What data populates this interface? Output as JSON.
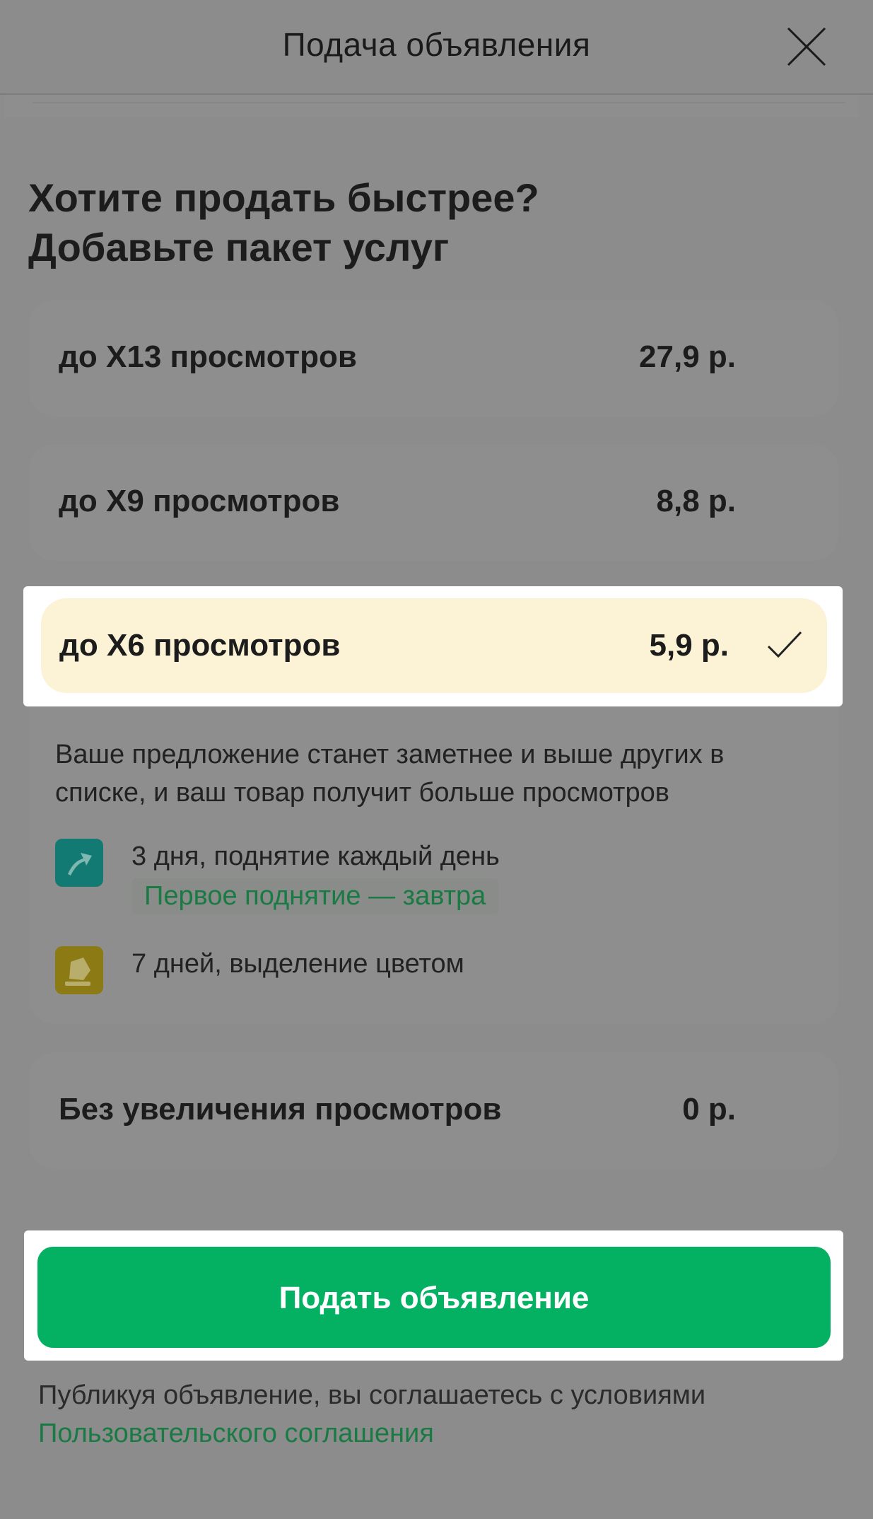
{
  "header": {
    "title": "Подача объявления",
    "close_icon": "close-icon"
  },
  "section": {
    "title_line1": "Хотите продать быстрее?",
    "title_line2": "Добавьте пакет услуг"
  },
  "packages": [
    {
      "label": "до Х13 просмотров",
      "price": "27,9 р.",
      "selected": false
    },
    {
      "label": "до Х9 просмотров",
      "price": "8,8 р.",
      "selected": false
    },
    {
      "label": "до Х6 просмотров",
      "price": "5,9 р.",
      "selected": true,
      "description": "Ваше предложение станет заметнее и выше других в списке, и ваш товар получит больше просмотров",
      "features": [
        {
          "icon": "lift-arrow-icon",
          "text": "3 дня, поднятие каждый день",
          "note": "Первое поднятие — завтра"
        },
        {
          "icon": "color-highlight-icon",
          "text": "7 дней, выделение цветом"
        }
      ]
    },
    {
      "label": "Без увеличения просмотров",
      "price": "0 р.",
      "selected": false
    }
  ],
  "submit": {
    "label": "Подать объявление"
  },
  "terms": {
    "text": "Публикуя объявление, вы соглашаетесь с условиями",
    "link": "Пользовательского соглашения"
  },
  "colors": {
    "accent": "#04b062",
    "selected_bg": "#fcf3d6",
    "overlay": "#8c8c8c"
  }
}
